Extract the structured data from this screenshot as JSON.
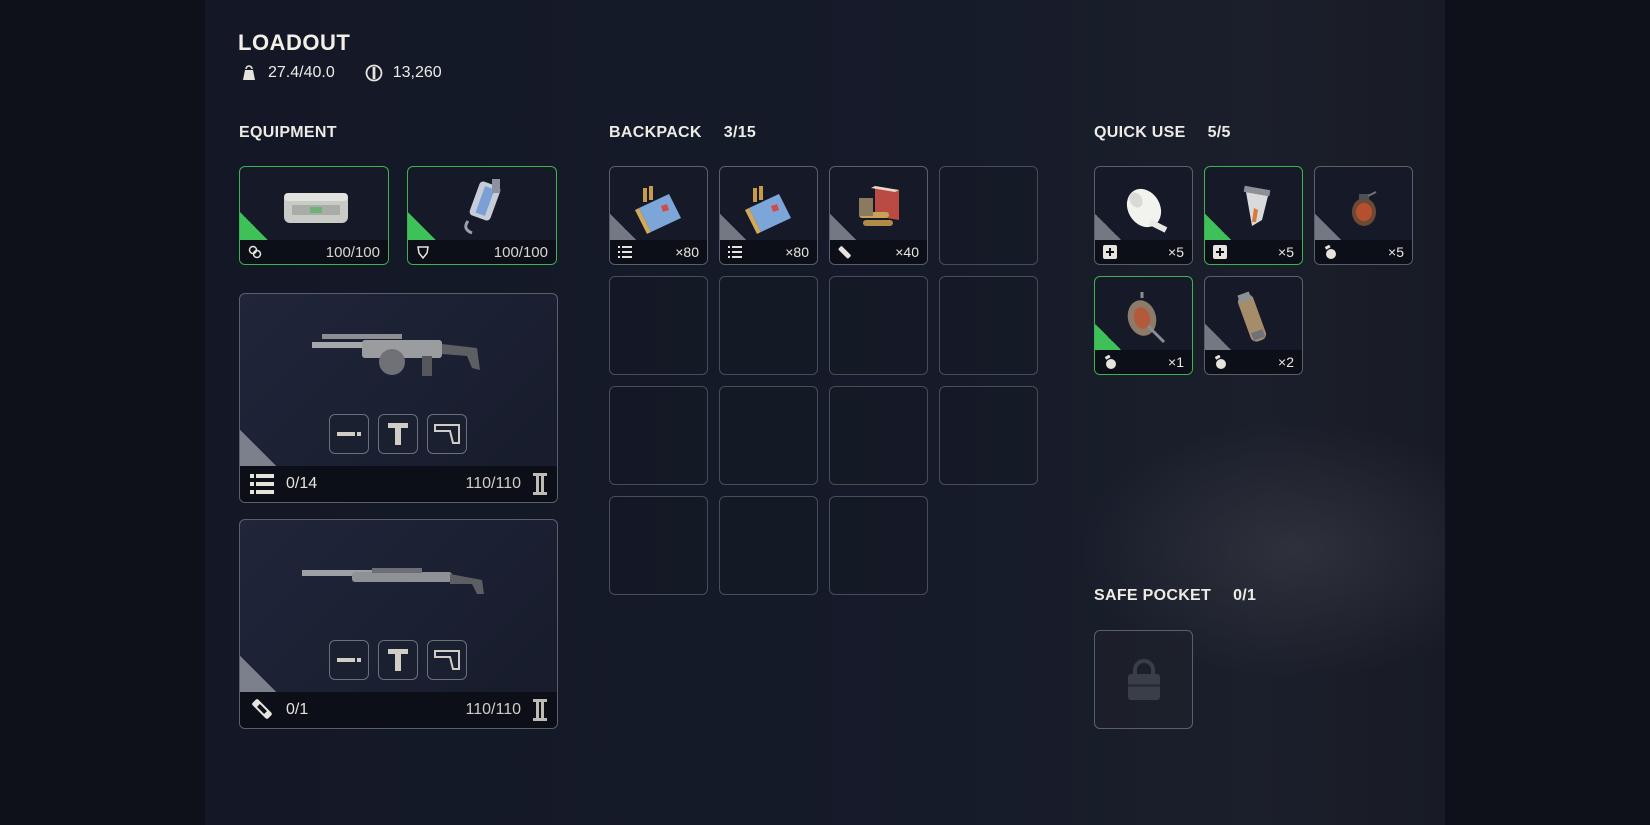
{
  "header": {
    "title": "LOADOUT",
    "weight": "27.4/40.0",
    "currency": "13,260",
    "icons": [
      "weight-icon",
      "coin-icon"
    ]
  },
  "equipment": {
    "label": "EQUIPMENT",
    "items": [
      {
        "name": "augment",
        "icon": "augment-icon",
        "durability": "100/100"
      },
      {
        "name": "shield",
        "icon": "shield-icon",
        "durability": "100/100"
      }
    ],
    "weapons": [
      {
        "ammo": "0/14",
        "durability": "110/110",
        "ammo_icon": "light-ammo-icon"
      },
      {
        "ammo": "0/1",
        "durability": "110/110",
        "ammo_icon": "launcher-ammo-icon"
      }
    ]
  },
  "backpack": {
    "label": "BACKPACK",
    "count": "3/15",
    "items": [
      {
        "name": "light-ammo",
        "qty": "×80",
        "icon": "light-ammo-icon"
      },
      {
        "name": "light-ammo",
        "qty": "×80",
        "icon": "light-ammo-icon"
      },
      {
        "name": "launcher-ammo",
        "qty": "×40",
        "icon": "launcher-ammo-icon"
      }
    ]
  },
  "quick_use": {
    "label": "QUICK USE",
    "count": "5/5",
    "items": [
      {
        "name": "bandage",
        "qty": "×5",
        "icon": "medical-icon"
      },
      {
        "name": "stim",
        "qty": "×5",
        "icon": "medical-icon"
      },
      {
        "name": "grenade",
        "qty": "×5",
        "icon": "grenade-icon"
      },
      {
        "name": "mine",
        "qty": "×1",
        "icon": "grenade-icon"
      },
      {
        "name": "canister",
        "qty": "×2",
        "icon": "grenade-icon"
      }
    ]
  },
  "safe_pocket": {
    "label": "SAFE POCKET",
    "count": "0/1"
  },
  "colors": {
    "accent_green": "#3fb24f",
    "background": "#141826"
  }
}
